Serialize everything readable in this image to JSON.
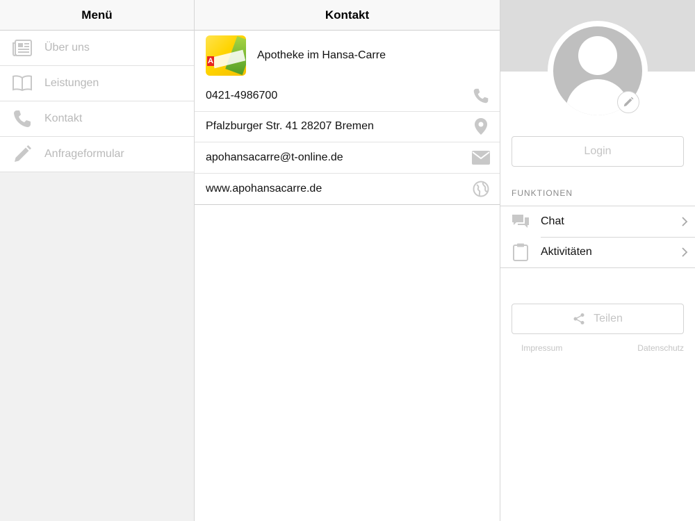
{
  "menu": {
    "title": "Menü",
    "items": [
      {
        "label": "Über uns",
        "icon": "newspaper-icon"
      },
      {
        "label": "Leistungen",
        "icon": "book-icon"
      },
      {
        "label": "Kontakt",
        "icon": "phone-icon"
      },
      {
        "label": "Anfrageformular",
        "icon": "pencil-icon"
      }
    ]
  },
  "contact": {
    "title": "Kontakt",
    "business_name": "Apotheke im Hansa-Carre",
    "phone": "0421-4986700",
    "address": "Pfalzburger Str. 41 28207 Bremen",
    "email": "apohansacarre@t-online.de",
    "website": "www.apohansacarre.de"
  },
  "profile": {
    "login_label": "Login",
    "functions_label": "FUNKTIONEN",
    "functions": [
      {
        "label": "Chat",
        "icon": "chat-icon"
      },
      {
        "label": "Aktivitäten",
        "icon": "clipboard-icon"
      }
    ],
    "share_label": "Teilen",
    "impressum_label": "Impressum",
    "privacy_label": "Datenschutz"
  },
  "colors": {
    "menu_background": "#f1f1f1",
    "disabled_text": "#b9b9b9",
    "icon_gray": "#c8c8c8",
    "header_band": "#dcdcdc"
  }
}
